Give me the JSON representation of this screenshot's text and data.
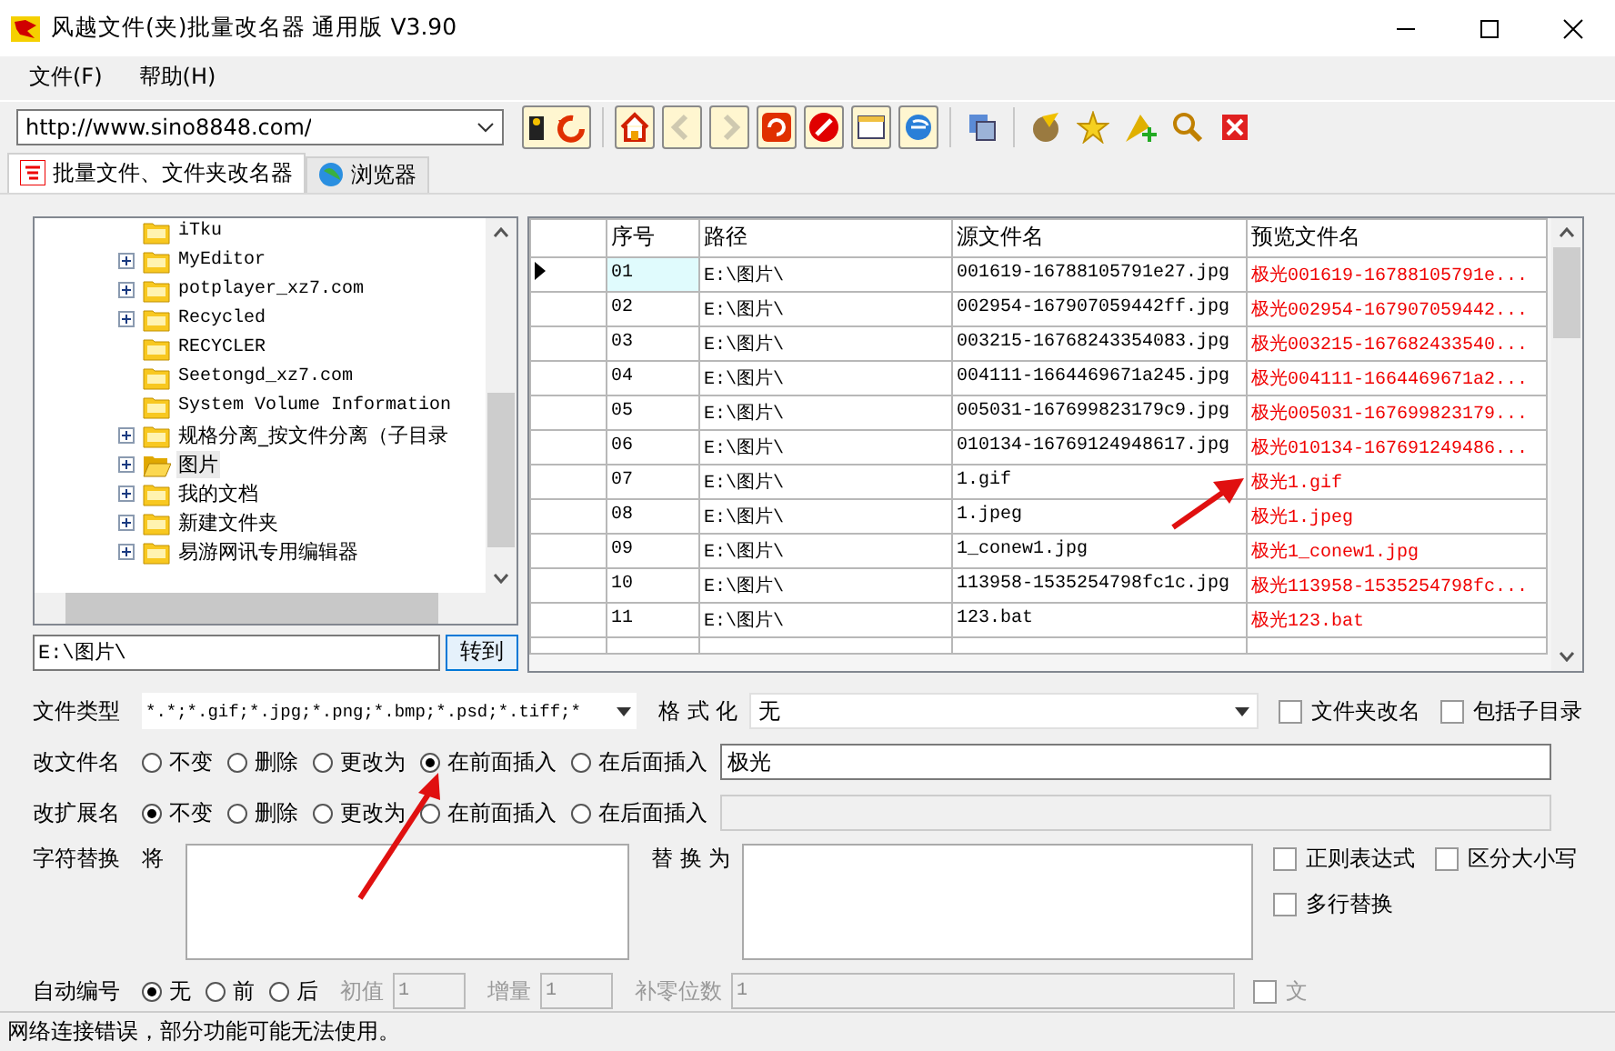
{
  "window": {
    "title": "风越文件(夹)批量改名器 通用版 V3.90"
  },
  "menu": [
    "文件(F)",
    "帮助(H)"
  ],
  "address": {
    "value": "http://www.sino8848.com/"
  },
  "toolbar": [
    {
      "kind": "go",
      "disabled": false
    },
    {
      "kind": "home",
      "disabled": false
    },
    {
      "kind": "back",
      "disabled": true
    },
    {
      "kind": "forward",
      "disabled": true
    },
    {
      "kind": "refresh",
      "disabled": false
    },
    {
      "kind": "stop",
      "disabled": false
    },
    {
      "kind": "window",
      "disabled": false
    },
    {
      "kind": "browser",
      "disabled": false
    },
    {
      "kind": "save",
      "disabled": false
    },
    {
      "kind": "paint",
      "disabled": false
    },
    {
      "kind": "star",
      "disabled": false
    },
    {
      "kind": "addfav",
      "disabled": false
    },
    {
      "kind": "search",
      "disabled": false
    },
    {
      "kind": "close",
      "disabled": false
    }
  ],
  "tabs": [
    {
      "label": "批量文件、文件夹改名器",
      "selected": true,
      "kind": "rename"
    },
    {
      "label": "浏览器",
      "selected": false,
      "kind": "globe"
    }
  ],
  "tree": {
    "items": [
      {
        "label": "iTku",
        "expandable": false,
        "selected": false
      },
      {
        "label": "MyEditor",
        "expandable": true,
        "selected": false
      },
      {
        "label": "potplayer_xz7.com",
        "expandable": true,
        "selected": false
      },
      {
        "label": "Recycled",
        "expandable": true,
        "selected": false
      },
      {
        "label": "RECYCLER",
        "expandable": false,
        "selected": false
      },
      {
        "label": "Seetongd_xz7.com",
        "expandable": false,
        "selected": false
      },
      {
        "label": "System Volume Information",
        "expandable": false,
        "selected": false
      },
      {
        "label": "规格分离_按文件分离（子目录",
        "expandable": true,
        "selected": false
      },
      {
        "label": "图片",
        "expandable": true,
        "selected": true
      },
      {
        "label": "我的文档",
        "expandable": true,
        "selected": false
      },
      {
        "label": "新建文件夹",
        "expandable": true,
        "selected": false
      },
      {
        "label": "易游网讯专用编辑器",
        "expandable": true,
        "selected": false
      }
    ]
  },
  "path": {
    "value": "E:\\图片\\",
    "go_button": "转到"
  },
  "table": {
    "columns": [
      "序号",
      "路径",
      "源文件名",
      "预览文件名"
    ],
    "rows": [
      {
        "no": "01",
        "path": "E:\\图片\\",
        "source": "001619-16788105791e27.jpg",
        "preview": "极光001619-16788105791e...",
        "current": true
      },
      {
        "no": "02",
        "path": "E:\\图片\\",
        "source": "002954-167907059442ff.jpg",
        "preview": "极光002954-167907059442...",
        "current": false
      },
      {
        "no": "03",
        "path": "E:\\图片\\",
        "source": "003215-16768243354083.jpg",
        "preview": "极光003215-167682433540...",
        "current": false
      },
      {
        "no": "04",
        "path": "E:\\图片\\",
        "source": "004111-1664469671a245.jpg",
        "preview": "极光004111-1664469671a2...",
        "current": false
      },
      {
        "no": "05",
        "path": "E:\\图片\\",
        "source": "005031-167699823179c9.jpg",
        "preview": "极光005031-167699823179...",
        "current": false
      },
      {
        "no": "06",
        "path": "E:\\图片\\",
        "source": "010134-16769124948617.jpg",
        "preview": "极光010134-167691249486...",
        "current": false
      },
      {
        "no": "07",
        "path": "E:\\图片\\",
        "source": "1.gif",
        "preview": "极光1.gif",
        "current": false
      },
      {
        "no": "08",
        "path": "E:\\图片\\",
        "source": "1.jpeg",
        "preview": "极光1.jpeg",
        "current": false
      },
      {
        "no": "09",
        "path": "E:\\图片\\",
        "source": "1_conew1.jpg",
        "preview": "极光1_conew1.jpg",
        "current": false
      },
      {
        "no": "10",
        "path": "E:\\图片\\",
        "source": "113958-1535254798fc1c.jpg",
        "preview": "极光113958-1535254798fc...",
        "current": false
      },
      {
        "no": "11",
        "path": "E:\\图片\\",
        "source": "123.bat",
        "preview": "极光123.bat",
        "current": false
      }
    ]
  },
  "file_type": {
    "label": "文件类型",
    "value": "*.*;*.gif;*.jpg;*.png;*.bmp;*.psd;*.tiff;*"
  },
  "format": {
    "label": "格 式 化",
    "value": "无"
  },
  "top_checks": [
    {
      "label": "文件夹改名",
      "checked": false
    },
    {
      "label": "包括子目录",
      "checked": false
    }
  ],
  "rename_file": {
    "label": "改文件名",
    "options": [
      {
        "label": "不变",
        "selected": false
      },
      {
        "label": "删除",
        "selected": false
      },
      {
        "label": "更改为",
        "selected": false
      },
      {
        "label": "在前面插入",
        "selected": true
      },
      {
        "label": "在后面插入",
        "selected": false
      }
    ],
    "value": "极光"
  },
  "rename_ext": {
    "label": "改扩展名",
    "options": [
      {
        "label": "不变",
        "selected": true
      },
      {
        "label": "删除",
        "selected": false
      },
      {
        "label": "更改为",
        "selected": false
      },
      {
        "label": "在前面插入",
        "selected": false
      },
      {
        "label": "在后面插入",
        "selected": false
      }
    ],
    "disabled": true
  },
  "replace": {
    "label": "字符替换",
    "from_label": "将",
    "to_label": "替 换 为",
    "checks": [
      {
        "label": "正则表达式",
        "checked": false
      },
      {
        "label": "区分大小写",
        "checked": false
      },
      {
        "label": "多行替换",
        "checked": false
      }
    ]
  },
  "auto_number": {
    "label": "自动编号",
    "options": [
      {
        "label": "无",
        "selected": true
      },
      {
        "label": "前",
        "selected": false
      },
      {
        "label": "后",
        "selected": false
      }
    ],
    "fields": [
      {
        "label": "初值",
        "value": "1"
      },
      {
        "label": "增量",
        "value": "1"
      },
      {
        "label": "补零位数",
        "value": "1"
      }
    ],
    "disabled": true,
    "check": {
      "label": "文",
      "checked": false
    }
  },
  "status_bar": "网络连接错误，部分功能可能无法使用。"
}
